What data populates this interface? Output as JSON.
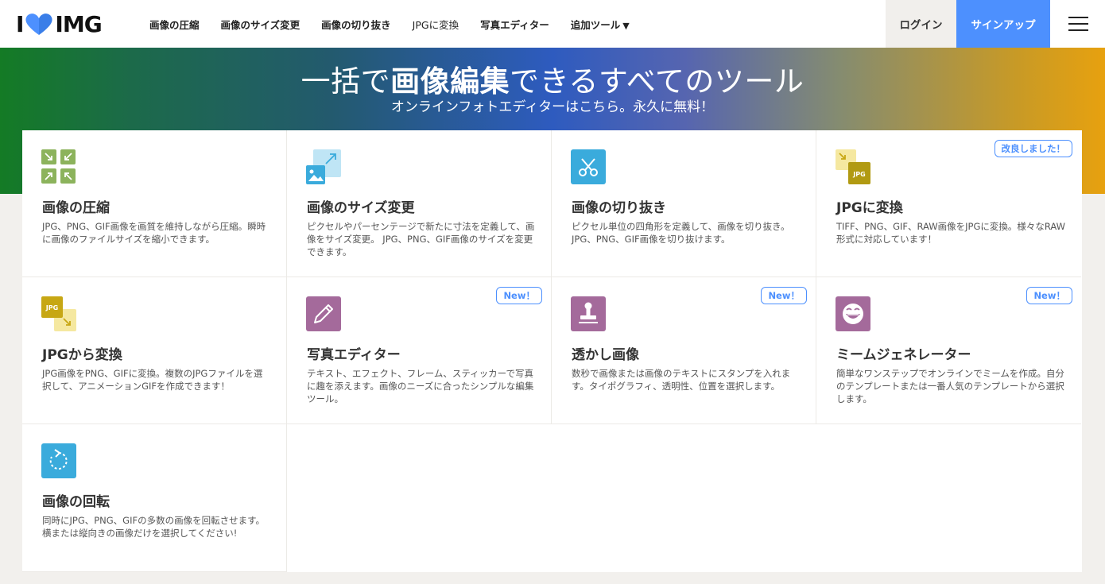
{
  "logo": {
    "text_left": "I",
    "text_right": "IMG"
  },
  "nav": {
    "items": [
      "画像の圧縮",
      "画像のサイズ変更",
      "画像の切り抜き",
      "JPGに変換",
      "写真エディター",
      "追加ツール"
    ]
  },
  "auth": {
    "login": "ログイン",
    "signup": "サインアップ"
  },
  "hero": {
    "title_pre": "一括で",
    "title_bold": "画像編集",
    "title_post": "できるすべてのツール",
    "subtitle": "オンラインフォトエディターはこちら。永久に無料！"
  },
  "tools": [
    {
      "title": "画像の圧縮",
      "desc": "JPG、PNG、GIF画像を画質を維持しながら圧縮。瞬時に画像のファイルサイズを縮小できます。",
      "badge": "",
      "icon": "compress-icon"
    },
    {
      "title": "画像のサイズ変更",
      "desc": "ピクセルやパーセンテージで新たに寸法を定義して、画像をサイズ変更。 JPG、PNG、GIF画像のサイズを変更できます。",
      "badge": "",
      "icon": "resize-icon"
    },
    {
      "title": "画像の切り抜き",
      "desc": "ピクセル単位の四角形を定義して、画像を切り抜き。JPG、PNG、GIF画像を切り抜けます。",
      "badge": "",
      "icon": "scissors-icon"
    },
    {
      "title": "JPGに変換",
      "desc": "TIFF、PNG、GIF、RAW画像をJPGに変換。様々なRAW形式に対応しています！",
      "badge": "改良しました！",
      "icon": "convert-to-jpg-icon"
    },
    {
      "title": "JPGから変換",
      "desc": "JPG画像をPNG、GIFに変換。複数のJPGファイルを選択して、アニメーションGIFを作成できます！",
      "badge": "",
      "icon": "convert-from-jpg-icon"
    },
    {
      "title": "写真エディター",
      "desc": "テキスト、エフェクト、フレーム、スティッカーで写真に趣を添えます。画像のニーズに合ったシンプルな編集ツール。",
      "badge": "New！",
      "icon": "pencil-icon"
    },
    {
      "title": "透かし画像",
      "desc": "数秒で画像または画像のテキストにスタンプを入れます。タイポグラフィ、透明性、位置を選択します。",
      "badge": "New！",
      "icon": "stamp-icon"
    },
    {
      "title": "ミームジェネレーター",
      "desc": "簡単なワンステップでオンラインでミームを作成。自分のテンプレートまたは一番人気のテンプレートから選択します。",
      "badge": "New！",
      "icon": "meme-face-icon"
    },
    {
      "title": "画像の回転",
      "desc": "同時にJPG、PNG、GIFの多数の画像を回転させます。横または縦向きの画像だけを選択してください!",
      "badge": "",
      "icon": "rotate-icon"
    }
  ],
  "icon_labels": {
    "jpg": "JPG"
  },
  "colors": {
    "accent_blue": "#4d90fe",
    "compress_green": "#8cb35c",
    "resize_blue": "#a6d9ef",
    "crop_blue": "#3aabdc",
    "jpg_yellow": "#c7a714",
    "editor_purple": "#a46a9b",
    "rotate_blue": "#3aabdc"
  }
}
